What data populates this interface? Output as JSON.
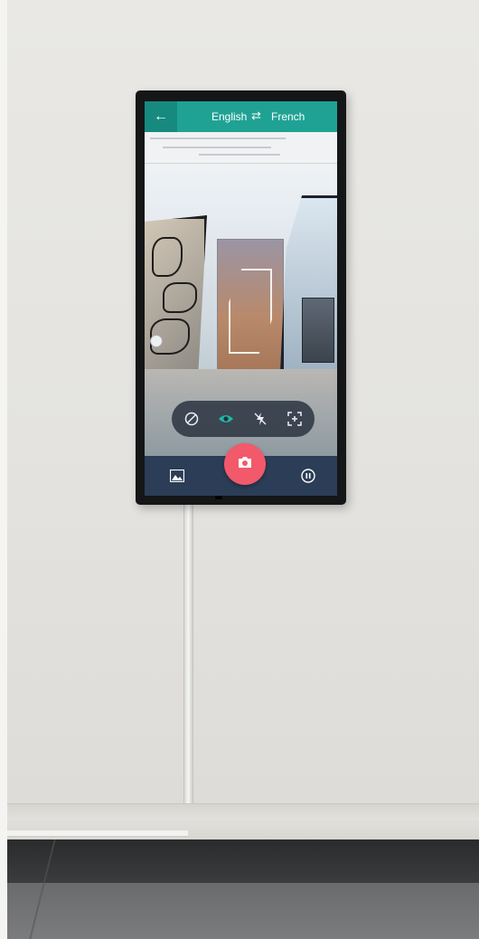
{
  "app_bar": {
    "back_icon": "arrow-left-icon",
    "source_language": "English",
    "swap_icon": "swap-arrows-icon",
    "target_language": "French"
  },
  "camera_controls": {
    "items": [
      "rotate-lock-icon",
      "eye-icon",
      "flash-off-icon",
      "focus-frame-icon"
    ]
  },
  "bottom_bar": {
    "gallery_icon": "image-gallery-icon",
    "shutter_icon": "camera-icon",
    "pause_icon": "pause-circle-icon"
  },
  "colors": {
    "app_bar": "#1fa294",
    "bottom_bar": "#2c3d57",
    "shutter": "#f2596a",
    "active_control": "#22b5a6"
  }
}
